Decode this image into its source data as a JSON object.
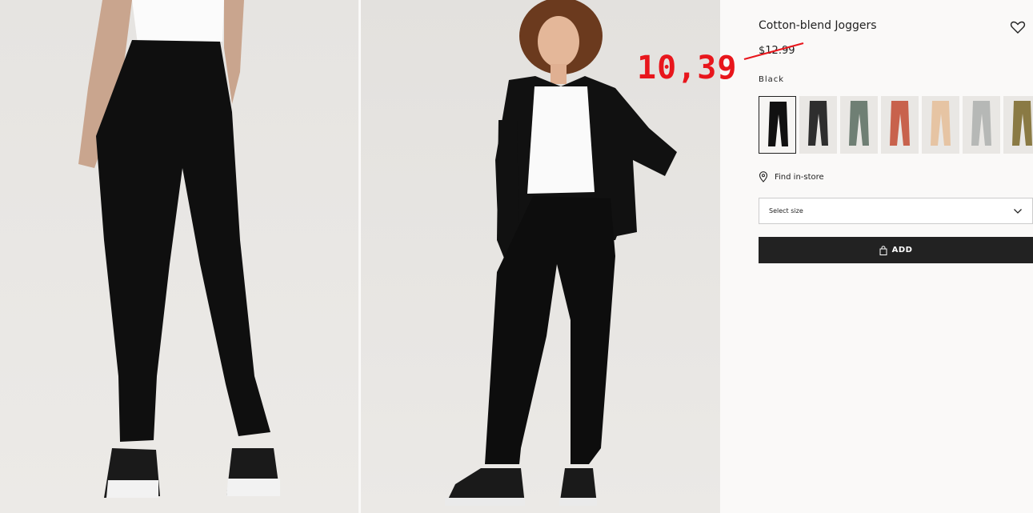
{
  "product": {
    "title": "Cotton-blend Joggers",
    "old_price": "$12.99",
    "new_price": "10,39",
    "color_name": "Black"
  },
  "swatches": [
    {
      "name": "black",
      "color": "#111111"
    },
    {
      "name": "dark-gray",
      "color": "#2e2e2e"
    },
    {
      "name": "sage-green",
      "color": "#6f7f74"
    },
    {
      "name": "rust",
      "color": "#c8624c"
    },
    {
      "name": "beige",
      "color": "#e6c4a3"
    },
    {
      "name": "light-gray",
      "color": "#b6b8b6"
    },
    {
      "name": "khaki",
      "color": "#8a7a44"
    }
  ],
  "find_store": {
    "label": "Find in-store",
    "icon": "location-pin-icon"
  },
  "size_select": {
    "label": "Select size",
    "icon": "chevron-down-icon"
  },
  "add_button": {
    "label": "ADD",
    "icon": "shopping-bag-icon"
  },
  "wishlist": {
    "icon": "heart-icon"
  },
  "colors": {
    "accent": "#e8161c",
    "button": "#222222"
  }
}
